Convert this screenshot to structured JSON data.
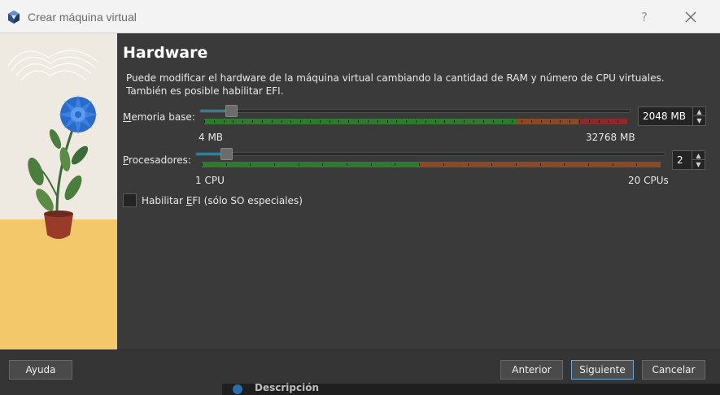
{
  "window": {
    "title": "Crear máquina virtual",
    "help_label": "?"
  },
  "page": {
    "heading": "Hardware",
    "description_line1": "Puede modificar el hardware de la máquina virtual cambiando la cantidad de RAM y número de CPU virtuales.",
    "description_line2": "También es posible habilitar EFI."
  },
  "memory": {
    "label_pre": "M",
    "label_rest": "emoria base:",
    "min_label": "4 MB",
    "max_label": "32768 MB",
    "value": "2048 MB",
    "level": 0.0625
  },
  "processors": {
    "label_pre": "P",
    "label_rest": "rocesadores:",
    "min_label": "1 CPU",
    "max_label": "20 CPUs",
    "value": "2",
    "level": 0.05
  },
  "efi": {
    "label_pre": "Habilitar ",
    "label_accel": "E",
    "label_rest": "FI (sólo SO especiales)",
    "checked": false
  },
  "footer": {
    "help": "Ayuda",
    "back": "Anterior",
    "next": "Siguiente",
    "cancel": "Cancelar"
  },
  "background": {
    "tab_label": "Descripción"
  },
  "colors": {
    "accent": "#2e7f9a",
    "scale_green": "#2f7a2f",
    "scale_orange": "#8a4a28",
    "scale_red": "#8a2a2a"
  },
  "icons": [
    "virtualbox-icon",
    "close-icon",
    "spin-up-icon",
    "spin-down-icon",
    "flower-illustration"
  ]
}
